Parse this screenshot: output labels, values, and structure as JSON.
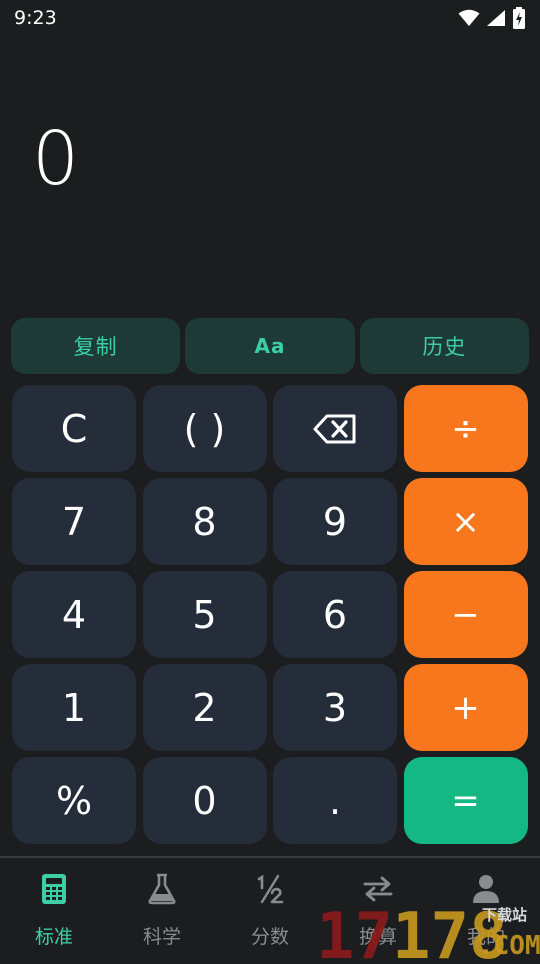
{
  "status": {
    "time": "9:23"
  },
  "display": {
    "value": "0"
  },
  "tools": [
    {
      "label": "复制"
    },
    {
      "label": "Aa"
    },
    {
      "label": "历史"
    }
  ],
  "keys": [
    {
      "label": "C",
      "name": "clear-key"
    },
    {
      "label": "( )",
      "name": "parentheses-key"
    },
    {
      "label": "",
      "name": "backspace-key"
    },
    {
      "label": "÷",
      "name": "divide-key"
    },
    {
      "label": "7",
      "name": "digit-7-key"
    },
    {
      "label": "8",
      "name": "digit-8-key"
    },
    {
      "label": "9",
      "name": "digit-9-key"
    },
    {
      "label": "×",
      "name": "multiply-key"
    },
    {
      "label": "4",
      "name": "digit-4-key"
    },
    {
      "label": "5",
      "name": "digit-5-key"
    },
    {
      "label": "6",
      "name": "digit-6-key"
    },
    {
      "label": "−",
      "name": "subtract-key"
    },
    {
      "label": "1",
      "name": "digit-1-key"
    },
    {
      "label": "2",
      "name": "digit-2-key"
    },
    {
      "label": "3",
      "name": "digit-3-key"
    },
    {
      "label": "+",
      "name": "add-key"
    },
    {
      "label": "%",
      "name": "percent-key"
    },
    {
      "label": "0",
      "name": "digit-0-key"
    },
    {
      "label": ".",
      "name": "decimal-key"
    },
    {
      "label": "=",
      "name": "equals-key"
    }
  ],
  "nav": [
    {
      "label": "标准",
      "icon": "calculator-icon"
    },
    {
      "label": "科学",
      "icon": "flask-icon"
    },
    {
      "label": "分数",
      "icon": "fraction-icon"
    },
    {
      "label": "换算",
      "icon": "swap-icon"
    },
    {
      "label": "我的",
      "icon": "person-icon"
    }
  ],
  "watermark": {
    "number": "17178",
    "small": "下载站",
    "suffix": ".COM"
  },
  "colors": {
    "background": "#1c1d1f",
    "accent": "#3ccfa6",
    "operator": "#f8761c",
    "equals": "#13b883",
    "key": "#252c3a"
  }
}
